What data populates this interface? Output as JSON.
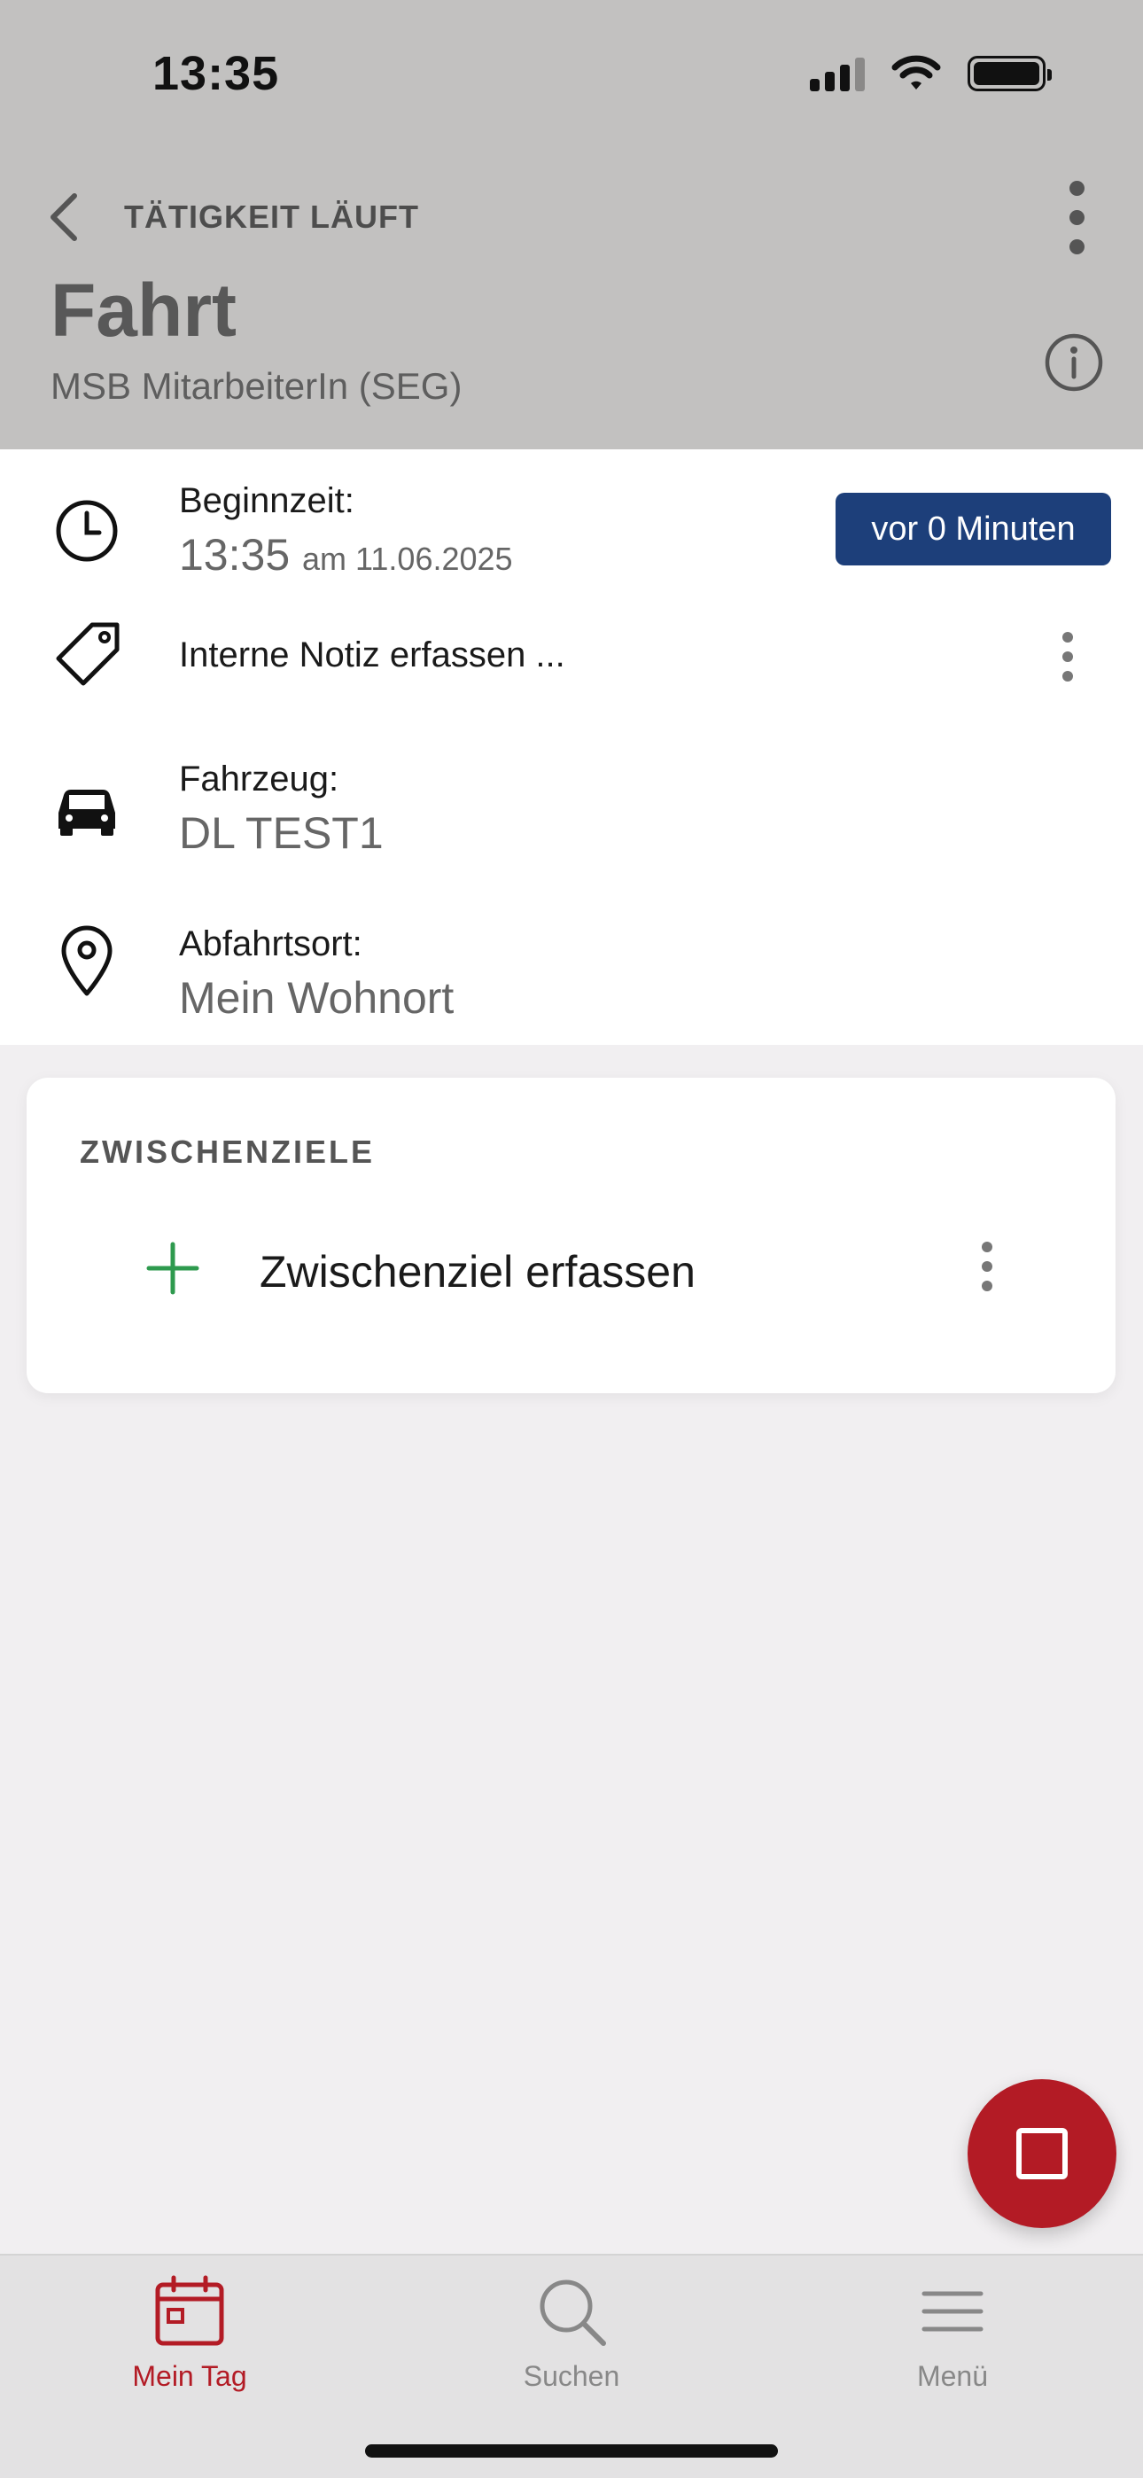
{
  "status_bar": {
    "time": "13:35"
  },
  "header": {
    "running_label": "TÄTIGKEIT LÄUFT",
    "title": "Fahrt",
    "subtitle": "MSB MitarbeiterIn (SEG)"
  },
  "details": {
    "begin": {
      "label": "Beginnzeit:",
      "time": "13:35",
      "date_text": "am 11.06.2025",
      "badge": "vor 0 Minuten"
    },
    "note": {
      "label": "Interne Notiz erfassen ..."
    },
    "vehicle": {
      "label": "Fahrzeug:",
      "value": "DL TEST1"
    },
    "departure": {
      "label": "Abfahrtsort:",
      "value": "Mein Wohnort"
    }
  },
  "waypoints": {
    "title": "ZWISCHENZIELE",
    "add_label": "Zwischenziel erfassen"
  },
  "bottom_nav": {
    "items": [
      {
        "label": "Mein Tag",
        "icon": "calendar-icon"
      },
      {
        "label": "Suchen",
        "icon": "search-icon"
      },
      {
        "label": "Menü",
        "icon": "menu-icon"
      }
    ]
  },
  "colors": {
    "accent_red": "#b31b25",
    "badge_blue": "#1d3f7a",
    "add_green": "#2e9a4e",
    "header_bg": "#c2c1c0"
  }
}
